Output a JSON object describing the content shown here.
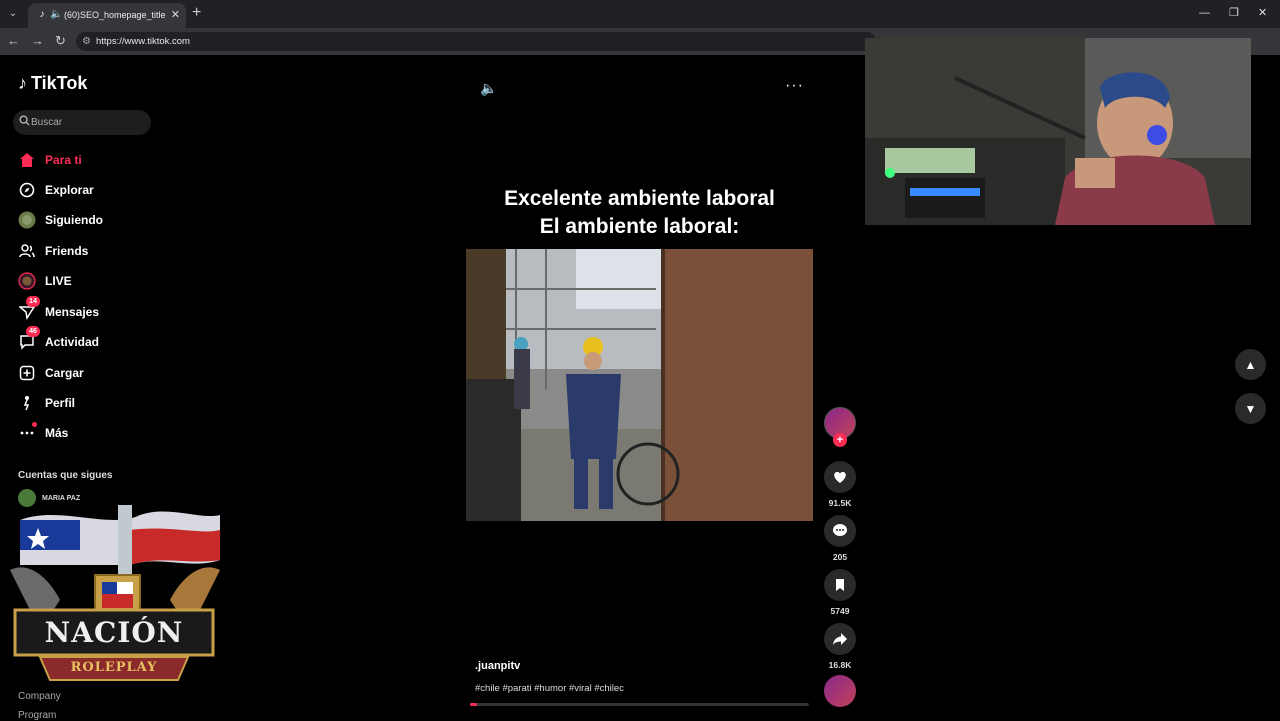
{
  "browser": {
    "tab_title": "(60)SEO_homepage_title",
    "url": "https://www.tiktok.com"
  },
  "sidebar": {
    "logo_text": "TikTok",
    "search_placeholder": "Buscar",
    "items": [
      {
        "label": "Para ti",
        "icon": "home-icon"
      },
      {
        "label": "Explorar",
        "icon": "compass-icon"
      },
      {
        "label": "Siguiendo",
        "icon": "following-avatar-icon"
      },
      {
        "label": "Friends",
        "icon": "friends-icon"
      },
      {
        "label": "LIVE",
        "icon": "live-icon"
      },
      {
        "label": "Mensajes",
        "icon": "messages-icon",
        "badge": "14"
      },
      {
        "label": "Actividad",
        "icon": "activity-icon",
        "badge": "46"
      },
      {
        "label": "Cargar",
        "icon": "upload-icon"
      },
      {
        "label": "Perfil",
        "icon": "profile-icon"
      },
      {
        "label": "Más",
        "icon": "more-icon"
      }
    ],
    "following_title": "Cuentas que sigues",
    "following_first": "MARIA PAZ",
    "footer_links": [
      "Company",
      "Program"
    ]
  },
  "overlay": {
    "title": "NACIÓN",
    "subtitle": "ROLEPLAY"
  },
  "video": {
    "caption_line1": "Excelente ambiente laboral",
    "caption_line2": "El ambiente laboral:",
    "username": ".juanpitv",
    "hashtags": "#chile #parati #humor #viral #chilec",
    "progress": 0.02
  },
  "actions": {
    "likes": "91.5K",
    "comments": "205",
    "saves": "5749",
    "shares": "16.8K"
  },
  "colors": {
    "accent": "#fe2c55",
    "background": "#000000"
  }
}
